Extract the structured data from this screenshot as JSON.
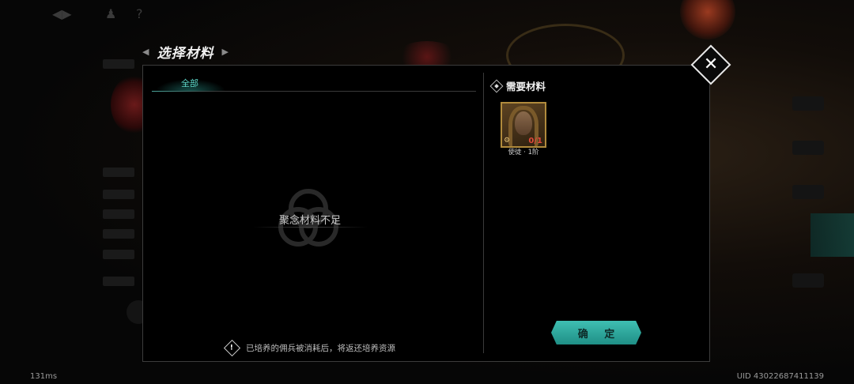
{
  "dialog": {
    "title": "选择材料",
    "close_icon": "close-x-icon"
  },
  "tabs": [
    {
      "label": "全部",
      "active": true
    }
  ],
  "empty_state": {
    "message": "聚念材料不足",
    "icon": "interlocked-rings-icon"
  },
  "notice": {
    "icon": "warning-diamond-icon",
    "text": "已培养的佣兵被消耗后，将返还培养资源"
  },
  "required": {
    "title": "需要材料",
    "items": [
      {
        "label": "使徒 · 1阶",
        "count": "0/1",
        "corner_icon": "gold-gear-icon"
      }
    ]
  },
  "confirm_label": "确 定",
  "footer": {
    "ping": "131ms",
    "uid": "UID 43022687411139"
  },
  "colors": {
    "accent_teal": "#3fbfb2",
    "count_red": "#e04a3a",
    "card_gold": "#b08a3c"
  }
}
